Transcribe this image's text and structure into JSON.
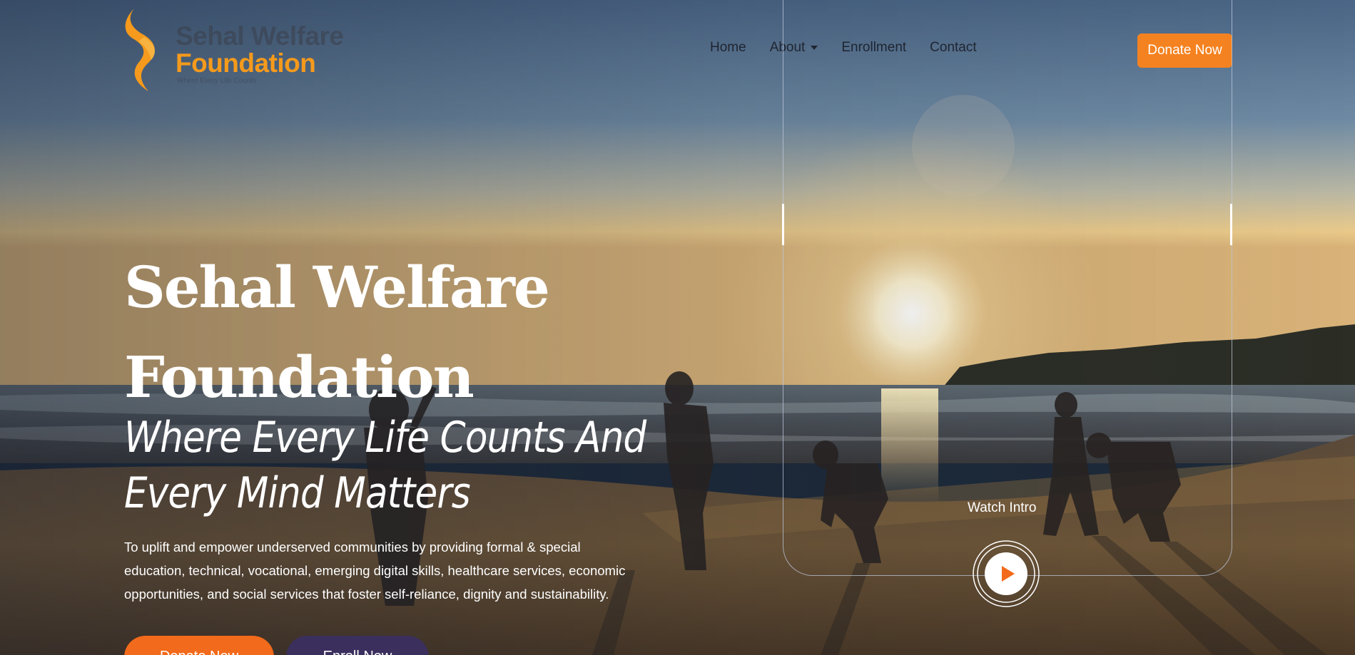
{
  "header": {
    "logo": {
      "line1": "Sehal Welfare",
      "line2": "Foundation",
      "tagline": "Where Every Life Counts"
    },
    "nav": [
      {
        "label": "Home"
      },
      {
        "label": "About",
        "has_dropdown": true
      },
      {
        "label": "Enrollment"
      },
      {
        "label": "Contact"
      }
    ],
    "donate_label": "Donate Now"
  },
  "hero": {
    "title_line1": "Sehal Welfare",
    "title_line2": "Foundation",
    "subtitle_line1": "Where Every Life Counts And",
    "subtitle_line2": "Every Mind Matters",
    "description_line1": "To uplift and empower underserved communities by providing formal & special",
    "description_line2": "education, technical, vocational, emerging digital skills, healthcare services, economic",
    "description_line3": "opportunities, and social services that foster self-reliance, dignity and sustainability.",
    "donate_button": "Donate Now",
    "enroll_button": "Enroll Now"
  },
  "video": {
    "watch_label": "Watch Intro",
    "play_icon": "play-icon"
  },
  "colors": {
    "accent_orange": "#f58220",
    "button_orange": "#f26a1b",
    "button_purple": "#3b2f5e",
    "logo_orange": "#f59a1c",
    "nav_text": "#1f2530"
  }
}
